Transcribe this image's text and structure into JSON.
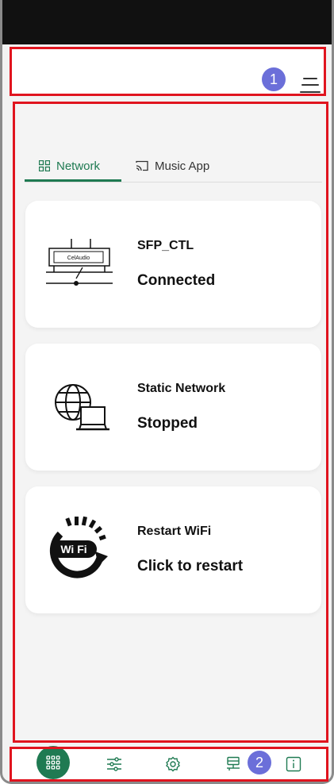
{
  "tabs": [
    {
      "label": "Network",
      "icon": "grid-icon",
      "active": true
    },
    {
      "label": "Music App",
      "icon": "cast-icon",
      "active": false
    }
  ],
  "cards": [
    {
      "name": "SFP_CTL",
      "status": "Connected",
      "icon": "device-icon",
      "device_label": "CelAudio"
    },
    {
      "name": "Static Network",
      "status": "Stopped",
      "icon": "globe-laptop-icon"
    },
    {
      "name": "Restart WiFi",
      "status": "Click to restart",
      "icon": "wifi-restart-icon",
      "icon_text": "Wi Fi"
    }
  ],
  "badges": {
    "header": "1",
    "footer": "2"
  },
  "nav": [
    {
      "icon": "apps-grid-icon",
      "active": true
    },
    {
      "icon": "sliders-icon",
      "active": false
    },
    {
      "icon": "settings-icon",
      "active": false
    },
    {
      "icon": "network-icon",
      "active": false
    },
    {
      "icon": "info-icon",
      "active": false
    }
  ],
  "colors": {
    "accent": "#1f7a52",
    "annotation": "#e0141e",
    "badge": "#6b6fd9"
  }
}
